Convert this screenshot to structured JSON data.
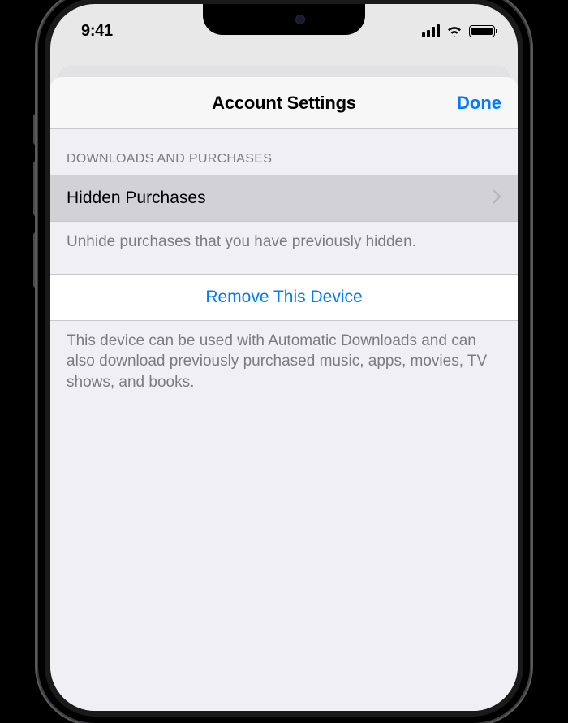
{
  "statusBar": {
    "time": "9:41"
  },
  "modal": {
    "title": "Account Settings",
    "doneLabel": "Done"
  },
  "section": {
    "header": "DOWNLOADS AND PURCHASES",
    "row1Label": "Hidden Purchases",
    "footer1": "Unhide purchases that you have previously hidden.",
    "actionLabel": "Remove This Device",
    "footer2": "This device can be used with Automatic Downloads and can also download previously purchased music, apps, movies, TV shows, and books."
  }
}
